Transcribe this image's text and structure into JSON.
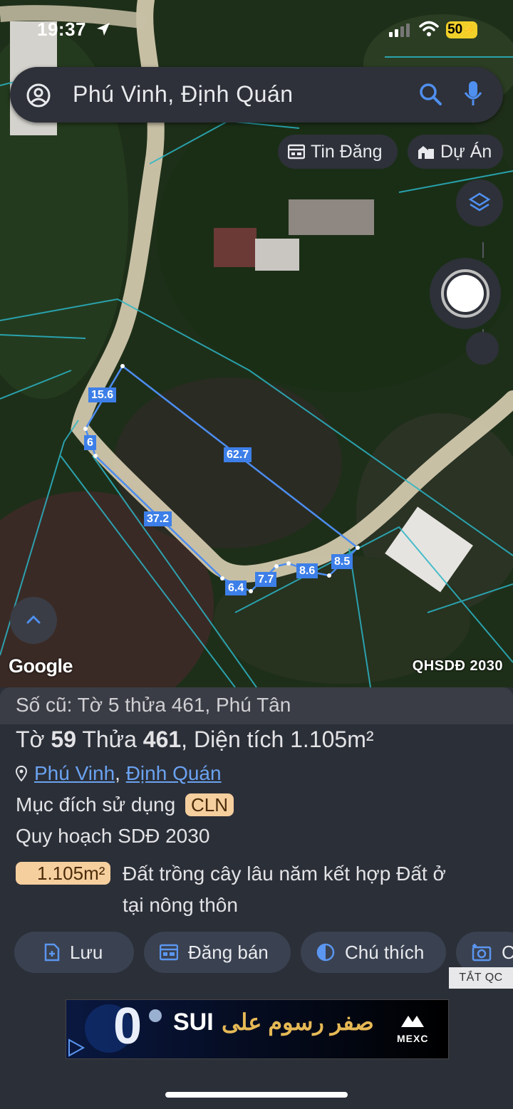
{
  "status": {
    "time": "19:37",
    "battery": "50"
  },
  "search": {
    "text": "Phú Vinh, Định Quán"
  },
  "chips": {
    "listings": "Tin Đăng",
    "projects": "Dự Án"
  },
  "map": {
    "edge_labels": [
      "15.6",
      "6",
      "62.7",
      "37.2",
      "6.4",
      "7.7",
      "8.6",
      "8.5"
    ],
    "brand": "Google",
    "layer_label": "QHSDĐ 2030"
  },
  "parcel": {
    "old_number": "Số cũ: Tờ 5 thửa 461, Phú Tân",
    "title_prefix": "Tờ ",
    "sheet": "59",
    "title_mid": " Thửa ",
    "lot": "461",
    "title_area_prefix": ", Diện tích ",
    "area": "1.105",
    "area_unit": "m²",
    "location_1": "Phú Vinh",
    "location_sep": ",",
    "location_2": "Định Quán",
    "purpose_label": "Mục đích sử dụng",
    "purpose_code": "CLN",
    "plan_label": "Quy hoạch SDĐ 2030",
    "plan_area": "1.105m²",
    "plan_desc_1": "Đất trồng cây lâu năm kết hợp Đất ở",
    "plan_desc_2": "tại nông thôn"
  },
  "actions": {
    "save": "Lưu",
    "post": "Đăng bán",
    "legend": "Chú thích",
    "capture": "C"
  },
  "ad": {
    "close_label": "TẮT QC",
    "text_sui": "SUI",
    "text_arabic": "صفر رسوم على",
    "brand": "MEXC",
    "zero": "0"
  },
  "colors": {
    "accent": "#3d7fe8",
    "tag_bg": "#f6cf9e",
    "sheet_bg": "#2b2f38"
  }
}
